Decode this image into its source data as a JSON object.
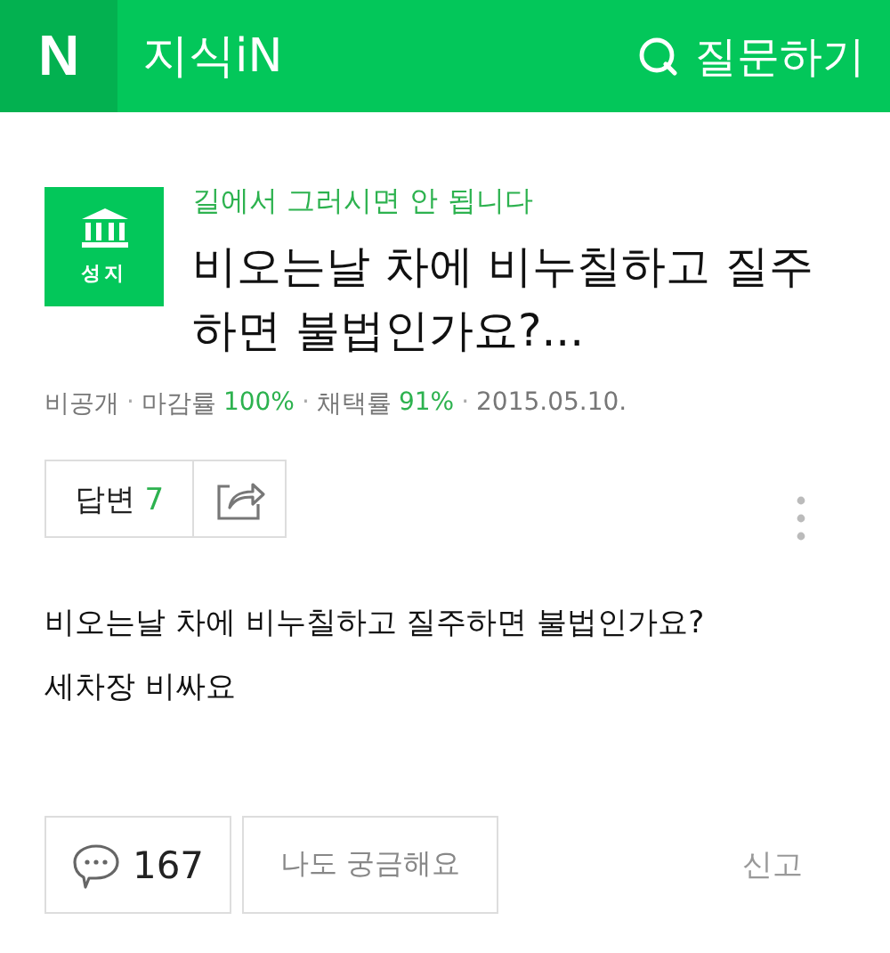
{
  "header": {
    "logo": "N",
    "title": "지식iN",
    "ask_button": "질문하기"
  },
  "question": {
    "badge": "성지",
    "category": "길에서 그러시면 안 됩니다",
    "title": "비오는날 차에 비누칠하고 질주하면 불법인가요?...",
    "meta": {
      "separator": "·",
      "visibility": "비공개",
      "close_rate_label": "마감률",
      "close_rate": "100%",
      "adopt_rate_label": "채택률",
      "adopt_rate": "91%",
      "date": "2015.05.10."
    },
    "answers_label": "답변",
    "answers_count": "7",
    "body": [
      "비오는날 차에 비누칠하고 질주하면 불법인가요?",
      "세차장 비싸요"
    ],
    "comment_count": "167",
    "curious_button": "나도 궁금해요",
    "report_link": "신고"
  }
}
